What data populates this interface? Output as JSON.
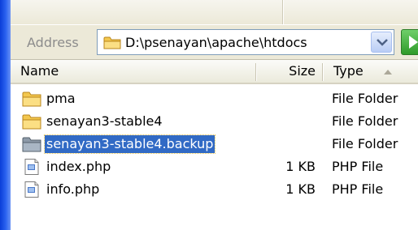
{
  "address_bar": {
    "label": "Address",
    "path": "D:\\psenayan\\apache\\htdocs"
  },
  "columns": {
    "name": "Name",
    "size": "Size",
    "type": "Type"
  },
  "files": [
    {
      "name": "pma",
      "size": "",
      "type": "File Folder",
      "icon": "folder-icon",
      "selected": false
    },
    {
      "name": "senayan3-stable4",
      "size": "",
      "type": "File Folder",
      "icon": "folder-icon",
      "selected": false
    },
    {
      "name": "senayan3-stable4.backup",
      "size": "",
      "type": "File Folder",
      "icon": "folder-icon",
      "selected": true
    },
    {
      "name": "index.php",
      "size": "1 KB",
      "type": "PHP File",
      "icon": "php-file-icon",
      "selected": false
    },
    {
      "name": "info.php",
      "size": "1 KB",
      "type": "PHP File",
      "icon": "php-file-icon",
      "selected": false
    }
  ],
  "colors": {
    "selection": "#316ac5",
    "frame": "#2b63f0",
    "folder": "#f3c74e"
  }
}
